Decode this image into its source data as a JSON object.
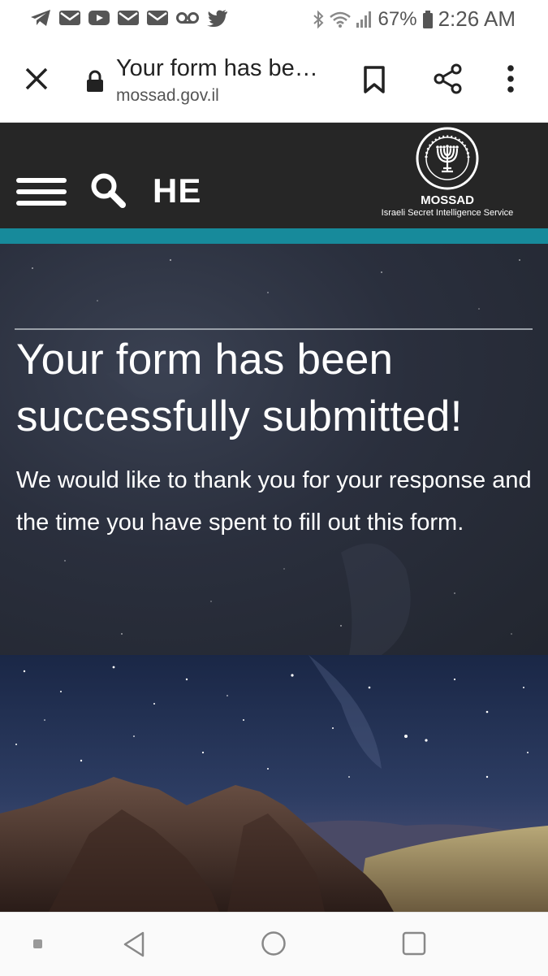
{
  "status_bar": {
    "battery_percent": "67%",
    "time": "2:26 AM",
    "icons": [
      "telegram-icon",
      "mail-icon",
      "youtube-icon",
      "mail-icon",
      "mail-icon",
      "voicemail-icon",
      "twitter-icon",
      "bluetooth-icon",
      "wifi-icon",
      "signal-icon",
      "battery-icon"
    ]
  },
  "browser": {
    "page_title": "Your form has be…",
    "url": "mossad.gov.il"
  },
  "site_header": {
    "language_toggle": "HE",
    "logo_name": "MOSSAD",
    "logo_tagline": "Israeli Secret Intelligence Service",
    "accent_color": "#178a9b"
  },
  "main": {
    "heading_line1": "Your form has been",
    "heading_line2": "successfully submitted!",
    "body_text": "We would like to thank you for your response and the time you have spent to fill out this form."
  },
  "nav_bar": {
    "icons": [
      "recents-dot-icon",
      "back-icon",
      "home-icon",
      "overview-icon"
    ]
  }
}
